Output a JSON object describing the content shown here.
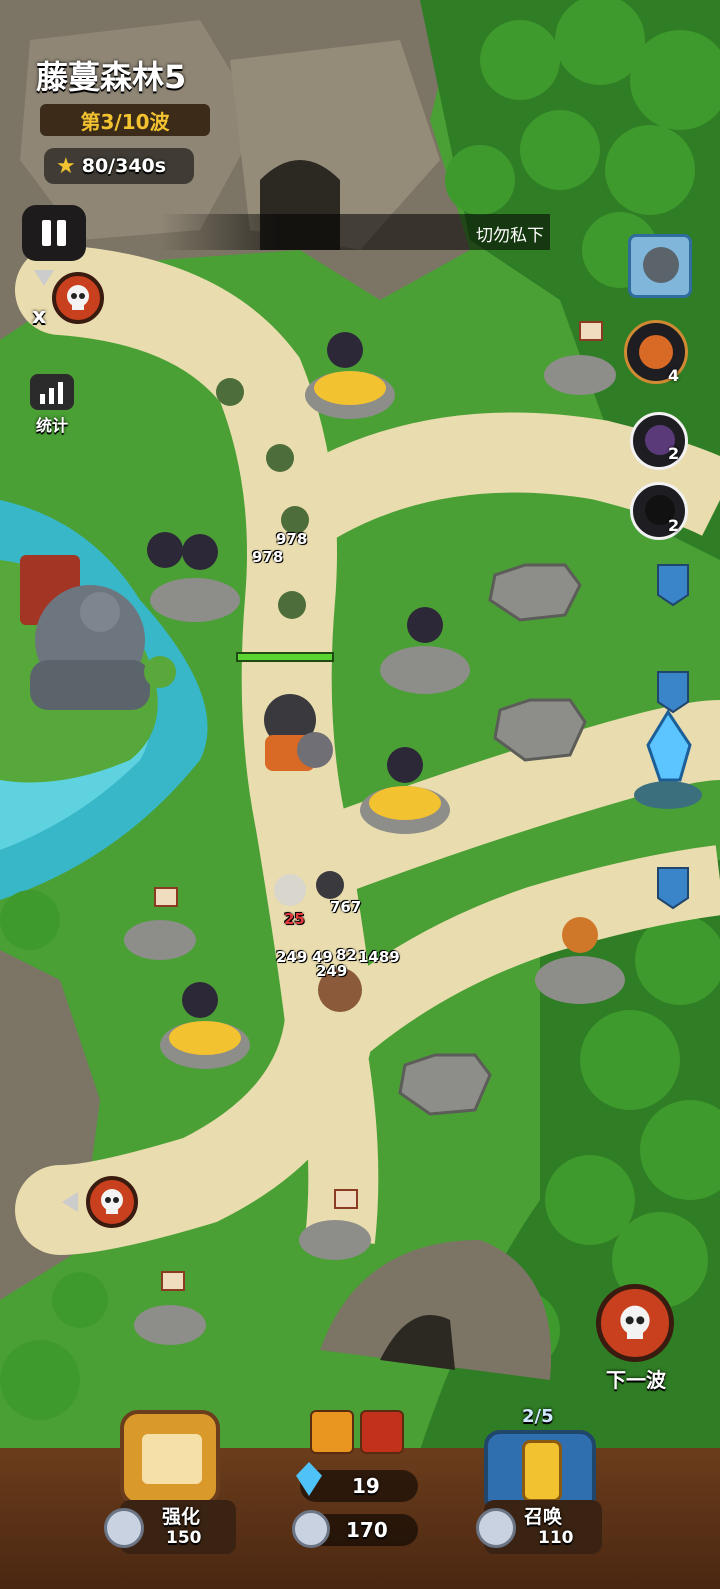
{
  "level": {
    "title": "藤蔓森林5",
    "wave": "第3/10波",
    "timer": "80/340s"
  },
  "ticker": {
    "text": "切勿私下"
  },
  "controls": {
    "speed": "x",
    "stats_label": "统计",
    "next_wave_label": "下一波"
  },
  "enemy_queue": [
    {
      "name": "orc-boss",
      "count": ""
    },
    {
      "name": "ninja",
      "count": "4"
    },
    {
      "name": "shadow-mage",
      "count": "2"
    },
    {
      "name": "shadow-imp",
      "count": "2"
    }
  ],
  "damage_numbers": [
    "978",
    "978",
    "767",
    "249",
    "49",
    "82",
    "1489",
    "249",
    "25"
  ],
  "bottom": {
    "upgrade_label": "强化",
    "upgrade_cost": "150",
    "crystals": "19",
    "coins": "170",
    "summon_label": "召唤",
    "summon_cost": "110",
    "summon_charges": "2/5"
  },
  "colors": {
    "accent_gold": "#f2c230",
    "grass": "#3c8f2c",
    "path": "#e9dcae",
    "water": "#38b7c9"
  },
  "icons": [
    "pause-icon",
    "skull-icon",
    "stats-icon",
    "star-icon",
    "crystal-icon",
    "coin-icon",
    "spellbook-icon",
    "summon-card-icon"
  ]
}
